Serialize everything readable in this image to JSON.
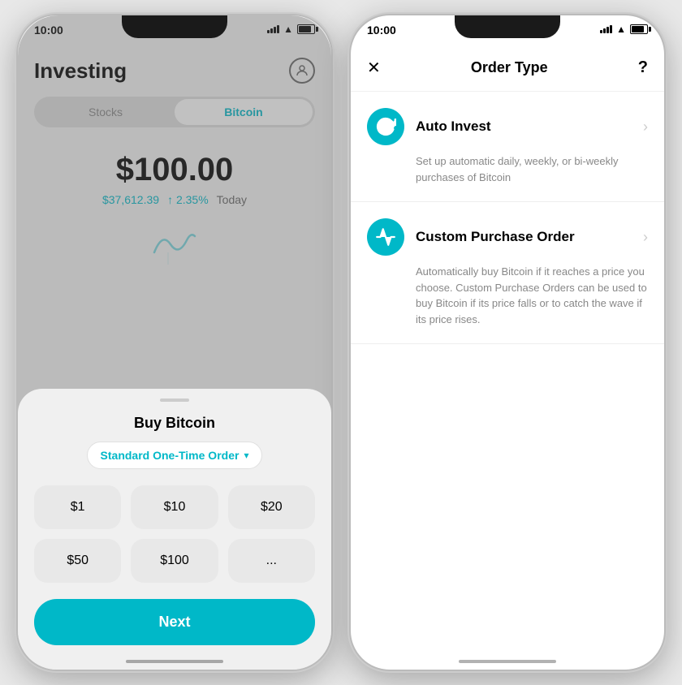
{
  "phone1": {
    "status": {
      "time": "10:00"
    },
    "header": {
      "title": "Investing"
    },
    "tabs": [
      {
        "label": "Stocks",
        "active": false
      },
      {
        "label": "Bitcoin",
        "active": true
      }
    ],
    "price": {
      "main": "$100.00",
      "btc": "$37,612.39",
      "change": "↑ 2.35%",
      "period": "Today"
    },
    "sheet": {
      "title": "Buy Bitcoin",
      "order_type": "Standard One-Time Order",
      "amounts": [
        "$1",
        "$10",
        "$20",
        "$50",
        "$100",
        "..."
      ],
      "next_label": "Next"
    }
  },
  "phone2": {
    "status": {
      "time": "10:00"
    },
    "header": {
      "close": "✕",
      "title": "Order Type",
      "help": "?"
    },
    "options": [
      {
        "name": "Auto Invest",
        "description": "Set up automatic daily, weekly, or bi-weekly purchases of Bitcoin",
        "icon_type": "refresh"
      },
      {
        "name": "Custom Purchase Order",
        "description": "Automatically buy Bitcoin if it reaches a price you choose. Custom Purchase Orders can be used to buy Bitcoin if its price falls or to catch the wave if its price rises.",
        "icon_type": "chart"
      }
    ]
  }
}
